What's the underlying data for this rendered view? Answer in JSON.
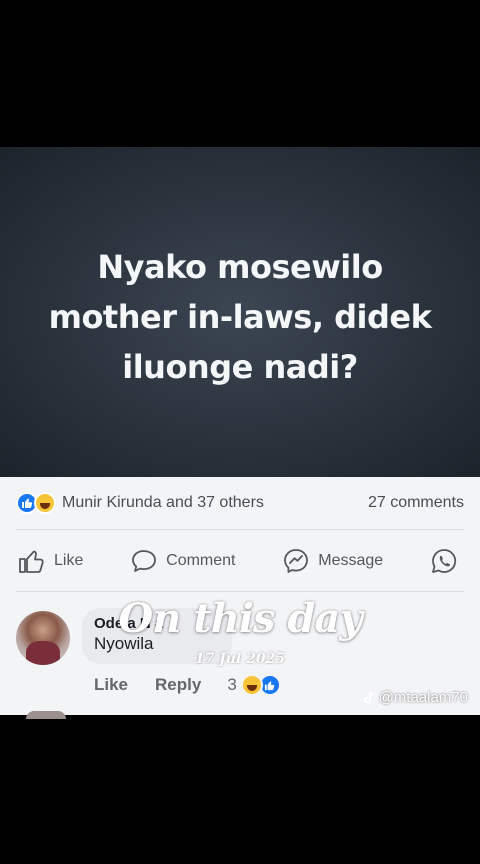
{
  "post": {
    "image_text": "Nyako mosewilo mother in-laws, didek iluonge nadi?"
  },
  "reactions": {
    "icons": [
      "like-icon",
      "haha-icon"
    ],
    "summary": "Munir Kirunda and 37 others",
    "comments_count": "27 comments"
  },
  "actions": {
    "like": "Like",
    "comment": "Comment",
    "message": "Message",
    "whatsapp_icon": "whatsapp-icon"
  },
  "comment": {
    "author": "Ode  a  N  a",
    "text": "Nyowila",
    "like_label": "Like",
    "reply_label": "Reply",
    "reaction_count": "3"
  },
  "overlay": {
    "title": "On this day",
    "date": "17 Jul 2025"
  },
  "watermark": {
    "handle": "@mtaalam70",
    "icon": "tiktok-icon"
  },
  "colors": {
    "facebook_blue": "#1877f2",
    "haha_yellow": "#f7c437",
    "card_bg": "#f3f4f6",
    "post_bg": "#2a323c"
  }
}
